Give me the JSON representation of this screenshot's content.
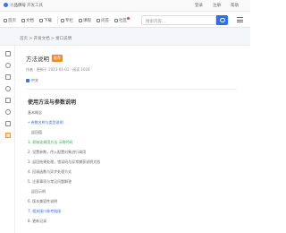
{
  "topbar": {
    "brand": "ⓐ品牌号",
    "sub": "开发工具",
    "right": [
      "登录",
      "注册",
      "帮助"
    ]
  },
  "toolbar": {
    "items": [
      {
        "label": "首页"
      },
      {
        "label": "文档"
      },
      {
        "label": "下载"
      },
      {
        "label": "专栏"
      },
      {
        "label": "课程"
      },
      {
        "label": "问答"
      },
      {
        "label": "社区"
      }
    ],
    "search_placeholder": "搜索内容..."
  },
  "breadcrumb": "首页 > 开发文档 > 接口说明",
  "article": {
    "title": "方法说明",
    "tag": "推荐",
    "meta": "作者 · 更新于 2023-01-01 · 阅读 1024",
    "lang": "中文",
    "heading": "使用方法与参数说明",
    "lines": [
      {
        "text": "基本概念",
        "style": "plain"
      },
      {
        "text": "• 参数名称与类型说明",
        "style": "blue"
      },
      {
        "text": "返回值",
        "style": "indent"
      },
      {
        "text": "1. 初始化调用方法  示例代码",
        "style": "green"
      },
      {
        "text": "2. 设置参数，传入配置对象进行调用",
        "style": "plain"
      },
      {
        "text": "3. 返回结果处理，错误码与异常捕获说明文档",
        "style": "plain"
      },
      {
        "text": "4. 回调函数与异步处理方式",
        "style": "plain"
      },
      {
        "text": "5. 注意事项与常见问题解答",
        "style": "plain"
      },
      {
        "text": "返回示例",
        "style": "indent"
      },
      {
        "text": "6. 版本兼容性说明",
        "style": "plain"
      },
      {
        "text": "7. 相关接口参考链接",
        "style": "blue"
      },
      {
        "text": "8. 更新记录",
        "style": "plain"
      }
    ]
  }
}
